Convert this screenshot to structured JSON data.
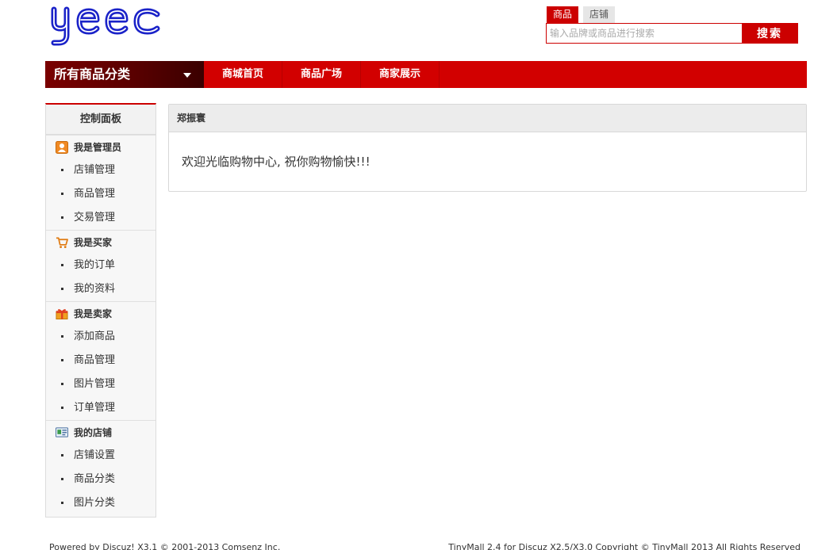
{
  "header": {
    "logo_text": "yeec",
    "search": {
      "tabs": [
        {
          "label": "商品",
          "active": true
        },
        {
          "label": "店铺",
          "active": false
        }
      ],
      "placeholder": "输入品牌或商品进行搜索",
      "button_label": "搜索"
    }
  },
  "nav": {
    "all_categories": "所有商品分类",
    "items": [
      "商城首页",
      "商品广场",
      "商家展示"
    ]
  },
  "sidebar": {
    "title": "控制面板",
    "groups": [
      {
        "label": "我是管理员",
        "icon": "admin-user-icon",
        "items": [
          "店铺管理",
          "商品管理",
          "交易管理"
        ]
      },
      {
        "label": "我是买家",
        "icon": "shopping-cart-icon",
        "items": [
          "我的订单",
          "我的资料"
        ]
      },
      {
        "label": "我是卖家",
        "icon": "gift-box-icon",
        "items": [
          "添加商品",
          "商品管理",
          "图片管理",
          "订单管理"
        ]
      },
      {
        "label": "我的店铺",
        "icon": "id-card-icon",
        "items": [
          "店铺设置",
          "商品分类",
          "图片分类"
        ]
      }
    ]
  },
  "main": {
    "username": "郑振寰",
    "welcome": "欢迎光临购物中心, 祝你购物愉快!!!"
  },
  "footer": {
    "left": "Powered by Discuz! X3.1 © 2001-2013 Comsenz Inc.",
    "right": "TinyMall 2.4 for Discuz X2.5/X3.0 Copyright © TinyMall 2013 All Rights Reserved"
  },
  "colors": {
    "brand_red": "#cc0000",
    "logo_blue": "#1a22c8"
  }
}
